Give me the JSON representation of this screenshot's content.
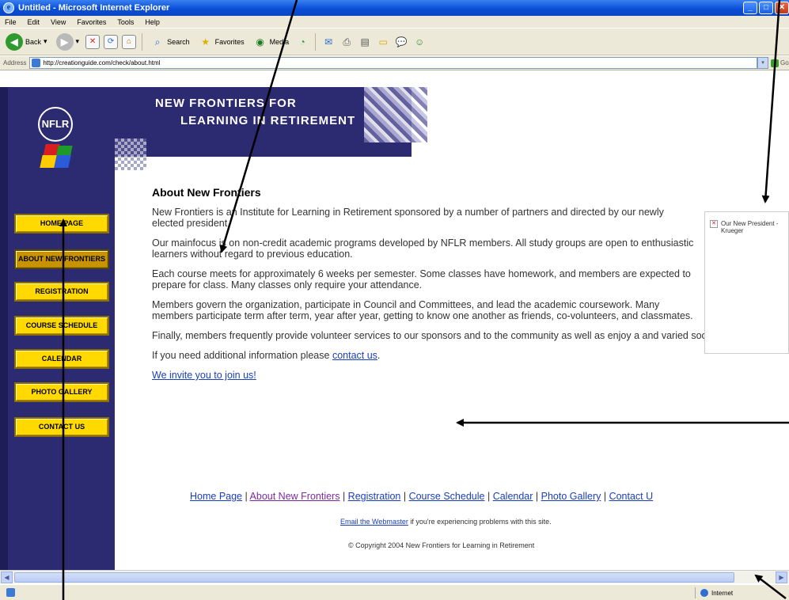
{
  "window": {
    "title": "Untitled - Microsoft Internet Explorer"
  },
  "menu": [
    "File",
    "Edit",
    "View",
    "Favorites",
    "Tools",
    "Help"
  ],
  "toolbar": {
    "back_label": "Back",
    "search_label": "Search",
    "favorites_label": "Favorites",
    "media_label": "Media"
  },
  "address": {
    "label": "Address",
    "url": "http://creationguide.com/check/about.html",
    "go_label": "Go"
  },
  "site": {
    "title_line1": "NEW FRONTIERS FOR",
    "title_line2": "LEARNING IN RETIREMENT",
    "logo_text": "NFLR"
  },
  "nav": [
    {
      "label": "HOME PAGE",
      "active": false
    },
    {
      "label": "ABOUT NEW FRONTIERS",
      "active": true
    },
    {
      "label": "REGISTRATION",
      "active": false
    },
    {
      "label": "COURSE SCHEDULE",
      "active": false
    },
    {
      "label": "CALENDAR",
      "active": false
    },
    {
      "label": "PHOTO GALLERY",
      "active": false
    },
    {
      "label": "CONTACT US",
      "active": false
    }
  ],
  "content": {
    "heading": "About New Frontiers",
    "p1": "New Frontiers is an Institute for Learning in Retirement sponsored by a number of partners and directed by our newly elected president.",
    "p2": "Our mainfocus is on non-credit academic programs developed by NFLR members. All study groups are open to enthusiastic learners without regard to previous education.",
    "p3": "Each course meets for approximately 6 weeks per semester. Some classes have homework, and members are expected to prepare for class. Many classes only require your attendance.",
    "p4": "Members govern the organization, participate in Council and Committees, and lead the academic coursework. Many members participate term after term, year after year, getting to know one another as friends, co-volunteers, and classmates.",
    "p5": "Finally, members frequently provide volunteer services to our sponsors and to the community as well as enjoy a and varied social calendar.",
    "contact_prefix": "If you need additional information please ",
    "contact_link": "contact us",
    "contact_suffix": ".",
    "join_link": "We invite you to join us!"
  },
  "photo": {
    "caption": "Our New President - Krueger"
  },
  "footer": {
    "links": [
      "Home Page",
      "About New Frontiers",
      "Registration",
      "Course Schedule",
      "Calendar",
      "Photo Gallery",
      "Contact U"
    ],
    "separator": " | ",
    "email_link": "Email the Webmaster",
    "email_suffix": " if you're experiencing problems with this site.",
    "copyright": "© Copyright 2004 New Frontiers for Learning in Retirement"
  },
  "status": {
    "zone": "Internet"
  },
  "colors": {
    "nav_bg": "#2c2a70",
    "button": "#ffd900",
    "link": "#1a3fbb",
    "visited": "#7b2aa0"
  }
}
